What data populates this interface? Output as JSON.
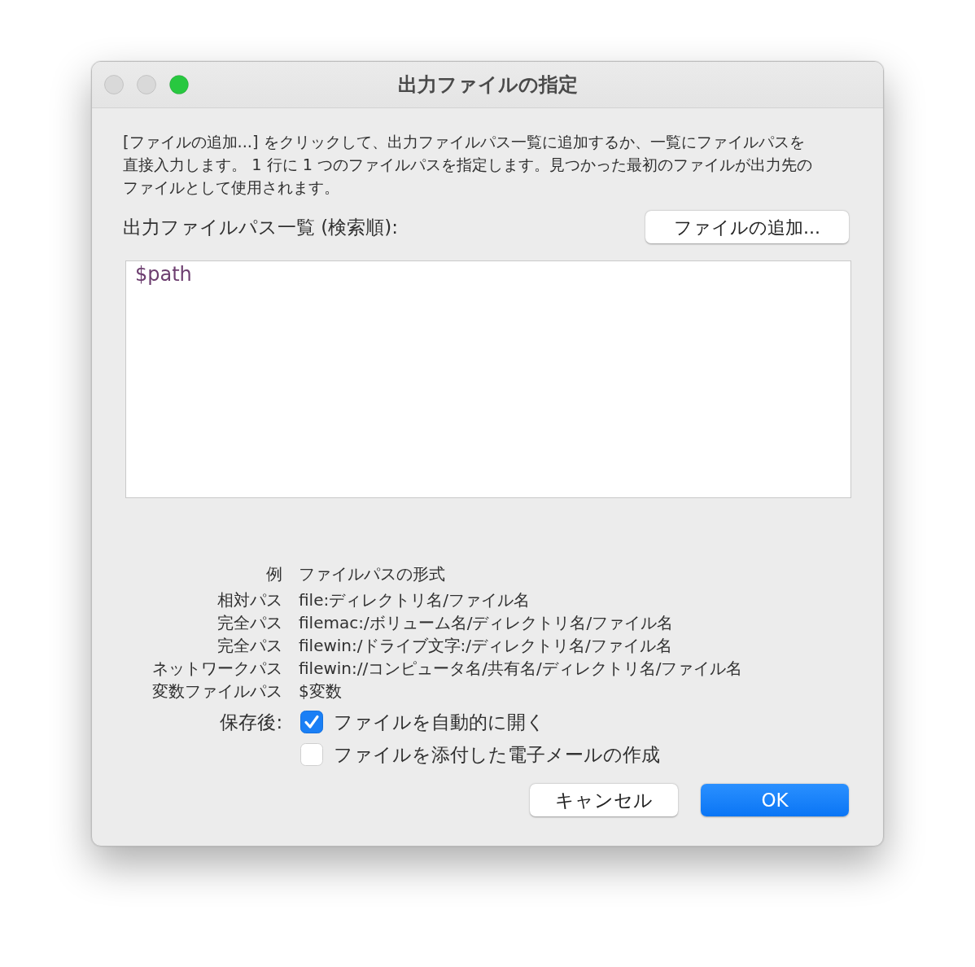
{
  "window": {
    "title": "出力ファイルの指定",
    "buttons": [
      {
        "color": "#d9d9d9"
      },
      {
        "color": "#d9d9d9"
      },
      {
        "color": "#28c840"
      }
    ]
  },
  "description": "[ファイルの追加...] をクリックして、出力ファイルパス一覧に追加するか、一覧にファイルパスを直接入力します。 1 行に 1 つのファイルパスを指定します。見つかった最初のファイルが出力先のファイルとして使用されます。",
  "path_list": {
    "label": "出力ファイルパス一覧 (検索順):",
    "add_button": "ファイルの追加...",
    "value": "$path"
  },
  "examples": {
    "header": {
      "label": "例",
      "format": "ファイルパスの形式"
    },
    "rows": [
      {
        "label": "相対パス",
        "format": "file:ディレクトリ名/ファイル名"
      },
      {
        "label": "完全パス",
        "format": "filemac:/ボリューム名/ディレクトリ名/ファイル名"
      },
      {
        "label": "完全パス",
        "format": "filewin:/ドライブ文字:/ディレクトリ名/ファイル名"
      },
      {
        "label": "ネットワークパス",
        "format": "filewin://コンピュータ名/共有名/ディレクトリ名/ファイル名"
      },
      {
        "label": "変数ファイルパス",
        "format": "$変数"
      }
    ]
  },
  "after_save": {
    "label": "保存後:",
    "options": [
      {
        "label": "ファイルを自動的に開く",
        "checked": true
      },
      {
        "label": "ファイルを添付した電子メールの作成",
        "checked": false
      }
    ]
  },
  "buttons": [
    {
      "label": "キャンセル",
      "kind": "default"
    },
    {
      "label": "OK",
      "kind": "primary"
    }
  ]
}
